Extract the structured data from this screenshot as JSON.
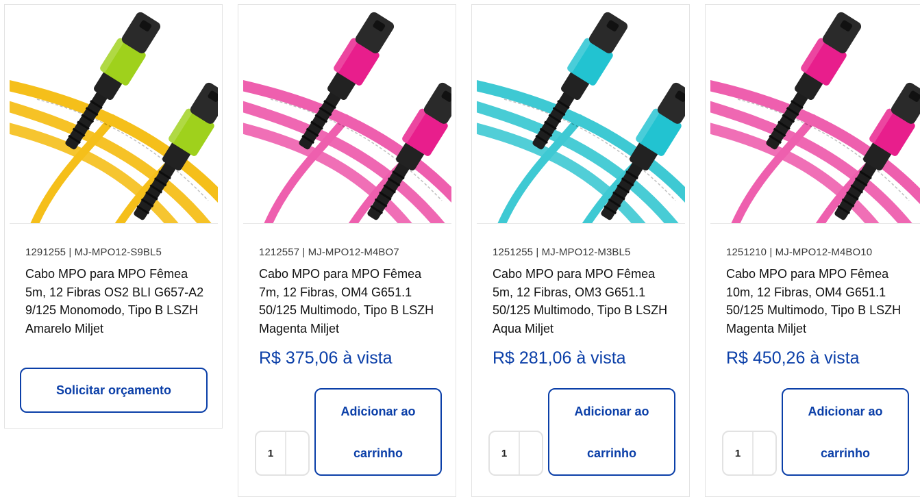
{
  "products": [
    {
      "sku": "1291255 | MJ-MPO12-S9BL5",
      "title": "Cabo MPO para MPO Fêmea 5m, 12 Fibras OS2 BLI G657-A2 9/125 Monomodo, Tipo B LSZH Amarelo Miljet",
      "action_label": "Solicitar orçamento",
      "cable_color": "#f5bf1a",
      "boot_color": "#9fd11c",
      "image_icon": "mpo-cable-yellow-image"
    },
    {
      "sku": "1212557 | MJ-MPO12-M4BO7",
      "title": "Cabo MPO para MPO Fêmea 7m, 12 Fibras, OM4 G651.1 50/125 Multimodo, Tipo B LSZH Magenta Miljet",
      "price": "R$ 375,06 à vista",
      "quantity": "1",
      "cart_label_line1": "Adicionar ao",
      "cart_label_line2": "carrinho",
      "cable_color": "#ee5fae",
      "boot_color": "#e81e8c",
      "image_icon": "mpo-cable-magenta-image"
    },
    {
      "sku": "1251255 | MJ-MPO12-M3BL5",
      "title": "Cabo MPO para MPO Fêmea 5m, 12 Fibras, OM3 G651.1 50/125 Multimodo, Tipo B LSZH Aqua Miljet",
      "price": "R$ 281,06 à vista",
      "quantity": "1",
      "cart_label_line1": "Adicionar ao",
      "cart_label_line2": "carrinho",
      "cable_color": "#3ec9d3",
      "boot_color": "#22c3d1",
      "image_icon": "mpo-cable-aqua-image"
    },
    {
      "sku": "1251210 | MJ-MPO12-M4BO10",
      "title": "Cabo MPO para MPO Fêmea 10m, 12 Fibras, OM4 G651.1 50/125 Multimodo, Tipo B LSZH Magenta Miljet",
      "price": "R$ 450,26 à vista",
      "quantity": "1",
      "cart_label_line1": "Adicionar ao",
      "cart_label_line2": "carrinho",
      "cable_color": "#ee5fae",
      "boot_color": "#e81e8c",
      "image_icon": "mpo-cable-magenta-image"
    }
  ],
  "colors": {
    "accent": "#0b3fa8",
    "border": "#e3e3e3"
  }
}
